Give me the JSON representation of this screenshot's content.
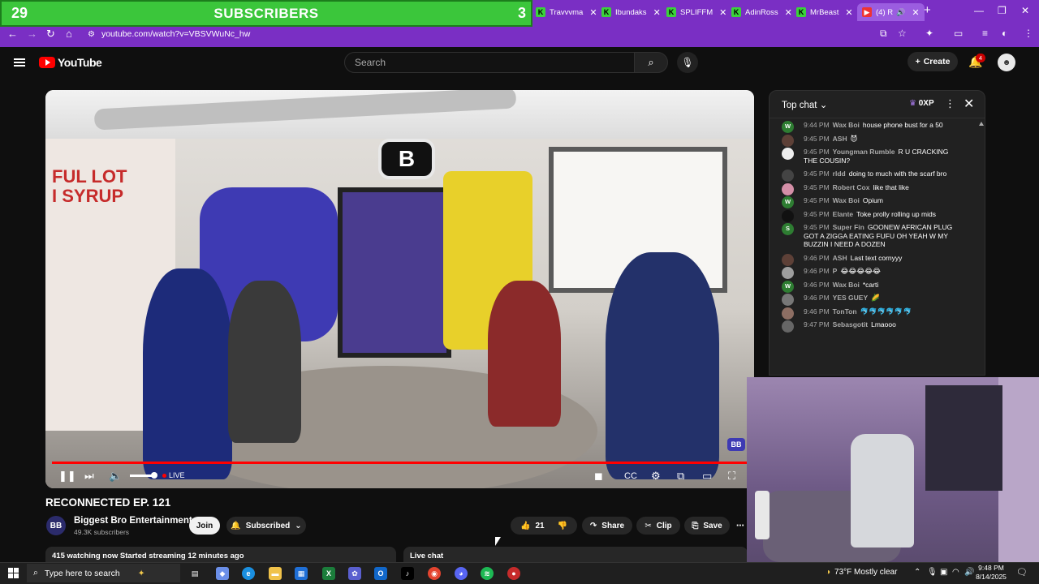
{
  "overlay": {
    "left_count": "29",
    "label": "SUBSCRIBERS",
    "right_count": "3"
  },
  "browser": {
    "tabs": [
      {
        "label": "Travvvma",
        "icon": "kick-icon"
      },
      {
        "label": "Ibundaks",
        "icon": "kick-icon"
      },
      {
        "label": "SPLIFFM",
        "icon": "kick-icon"
      },
      {
        "label": "AdinRoss",
        "icon": "kick-icon"
      },
      {
        "label": "MrBeast",
        "icon": "kick-icon"
      },
      {
        "label": "(4) R",
        "icon": "youtube-icon"
      }
    ],
    "url": "youtube.com/watch?v=VBSVWuNc_hw",
    "accent": "#7a2fc4"
  },
  "youtube": {
    "logo_text": "YouTube",
    "search_placeholder": "Search",
    "create_label": "Create",
    "notifications_count": "4"
  },
  "player": {
    "live_label": "LIVE",
    "wall_text": "FUL LOT\nI SYRUP",
    "progress_color": "#ff0000"
  },
  "video": {
    "title": "RECONNECTED EP. 121",
    "channel_name": "Biggest Bro Entertainment",
    "channel_subs": "49.3K subscribers",
    "join_label": "Join",
    "subscribed_label": "Subscribed",
    "likes": "21",
    "share_label": "Share",
    "clip_label": "Clip",
    "save_label": "Save",
    "watching_info": "415 watching now  Started streaming 12 minutes ago",
    "live_chat_label": "Live chat"
  },
  "chat": {
    "header": "Top chat",
    "xp": "0XP",
    "messages": [
      {
        "time": "9:44 PM",
        "user": "Wax Boi",
        "text": "house phone bust for a 50",
        "avatar": "W",
        "color": "#2e7d32"
      },
      {
        "time": "9:45 PM",
        "user": "ASH",
        "text": "😈",
        "avatar": "",
        "color": "#5d4037"
      },
      {
        "time": "9:45 PM",
        "user": "Youngman Rumble",
        "text": "R U CRACKING THE COUSIN?",
        "avatar": "",
        "color": "#eeeeee"
      },
      {
        "time": "9:45 PM",
        "user": "rldd",
        "text": "doing to much with the scarf bro",
        "avatar": "",
        "color": "#444444"
      },
      {
        "time": "9:45 PM",
        "user": "Robert Cox",
        "text": "like that like",
        "avatar": "",
        "color": "#d48fa7"
      },
      {
        "time": "9:45 PM",
        "user": "Wax Boi",
        "text": "Opium",
        "avatar": "W",
        "color": "#2e7d32"
      },
      {
        "time": "9:45 PM",
        "user": "Elante",
        "text": "Toke prolly rolling up mids",
        "avatar": "",
        "color": "#111111"
      },
      {
        "time": "9:45 PM",
        "user": "Super Fin",
        "text": "GOONEW AFRICAN PLUG GOT A ZIGGA EATING FUFU OH YEAH W MY BUZZIN I NEED A DOZEN",
        "avatar": "S",
        "color": "#2e7d32"
      },
      {
        "time": "9:46 PM",
        "user": "ASH",
        "text": "Last text cornyyy",
        "avatar": "",
        "color": "#5d4037"
      },
      {
        "time": "9:46 PM",
        "user": "P",
        "text": "😂😂😂😂😂",
        "avatar": "",
        "color": "#9e9e9e"
      },
      {
        "time": "9:46 PM",
        "user": "Wax Boi",
        "text": "*carti",
        "avatar": "W",
        "color": "#2e7d32"
      },
      {
        "time": "9:46 PM",
        "user": "YES GUEY",
        "text": "🌽",
        "avatar": "",
        "color": "#777777"
      },
      {
        "time": "9:46 PM",
        "user": "TonTon",
        "text": "🐬🐬🐬🐬🐬🐬",
        "avatar": "",
        "color": "#8d6e63"
      },
      {
        "time": "9:47 PM",
        "user": "Sebasgotit",
        "text": "Lmaooo",
        "avatar": "",
        "color": "#666666"
      }
    ]
  },
  "taskbar": {
    "search_placeholder": "Type here to search",
    "weather": "73°F  Mostly clear",
    "time": "9:48 PM",
    "date": "8/14/2025"
  }
}
